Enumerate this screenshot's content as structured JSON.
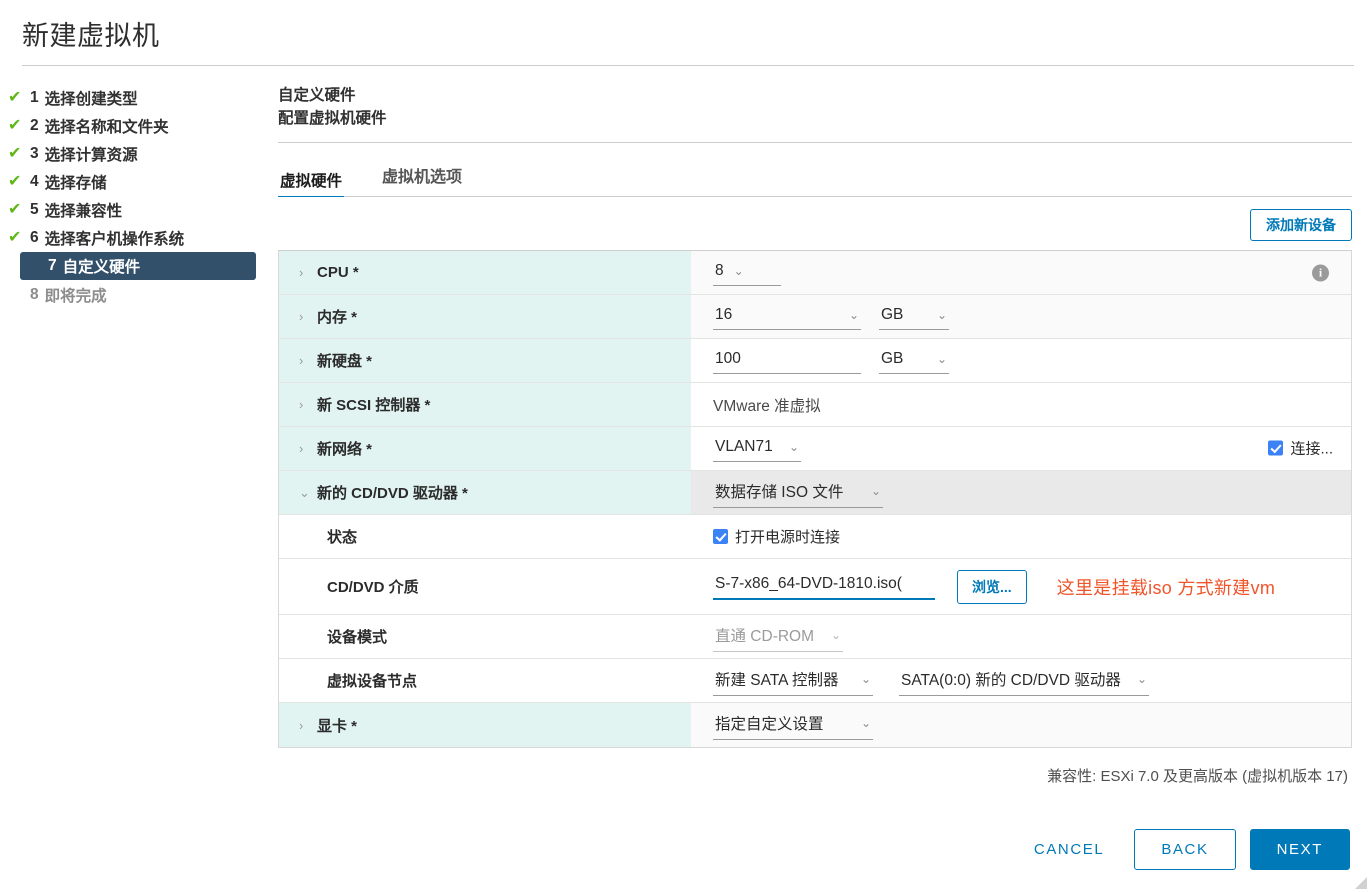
{
  "window": {
    "title": "新建虚拟机"
  },
  "sidebar": {
    "items": [
      {
        "num": "1",
        "label": "选择创建类型",
        "state": "done"
      },
      {
        "num": "2",
        "label": "选择名称和文件夹",
        "state": "done"
      },
      {
        "num": "3",
        "label": "选择计算资源",
        "state": "done"
      },
      {
        "num": "4",
        "label": "选择存储",
        "state": "done"
      },
      {
        "num": "5",
        "label": "选择兼容性",
        "state": "done"
      },
      {
        "num": "6",
        "label": "选择客户机操作系统",
        "state": "done"
      },
      {
        "num": "7",
        "label": "自定义硬件",
        "state": "active"
      },
      {
        "num": "8",
        "label": "即将完成",
        "state": "pending"
      }
    ],
    "check_glyph": "✔"
  },
  "pane": {
    "title": "自定义硬件",
    "subtitle": "配置虚拟机硬件"
  },
  "tabs": [
    {
      "label": "虚拟硬件",
      "selected": true
    },
    {
      "label": "虚拟机选项",
      "selected": false
    }
  ],
  "toolbar": {
    "add_device_label": "添加新设备"
  },
  "hardware": {
    "cpu": {
      "label": "CPU *",
      "value": "8",
      "caret": "›",
      "info_glyph": "i"
    },
    "memory": {
      "label": "内存 *",
      "value": "16",
      "unit": "GB",
      "caret": "›"
    },
    "harddisk": {
      "label": "新硬盘 *",
      "value": "100",
      "unit": "GB",
      "caret": "›"
    },
    "scsi": {
      "label": "新 SCSI 控制器 *",
      "value": "VMware 准虚拟",
      "caret": "›"
    },
    "network": {
      "label": "新网络 *",
      "value": "VLAN71",
      "connect_label": "连接...",
      "connect_checked": true,
      "caret": "›"
    },
    "cddvd": {
      "label": "新的 CD/DVD 驱动器 *",
      "value": "数据存储 ISO 文件",
      "caret": "⌄",
      "rows": {
        "status": {
          "label": "状态",
          "checkbox_label": "打开电源时连接",
          "checked": true
        },
        "media": {
          "label": "CD/DVD 介质",
          "value": ")S-7-x86_64-DVD-1810.iso",
          "browse_label": "浏览...",
          "annotation": "这里是挂载iso 方式新建vm"
        },
        "device_mode": {
          "label": "设备模式",
          "value": "直通 CD-ROM",
          "disabled": true
        },
        "device_node": {
          "label": "虚拟设备节点",
          "controller": "新建 SATA 控制器",
          "node": "SATA(0:0) 新的 CD/DVD 驱动器"
        }
      }
    },
    "videocard": {
      "label": "显卡 *",
      "value": "指定自定义设置",
      "caret": "›"
    }
  },
  "compatibility": "兼容性: ESXi 7.0 及更高版本 (虚拟机版本 17)",
  "footer": {
    "cancel": "CANCEL",
    "back": "BACK",
    "next": "NEXT"
  },
  "colors": {
    "accent": "#0079b8",
    "active_step": "#33506b",
    "check_green": "#5eb715",
    "label_cell": "#e1f4f1",
    "annotation": "#f0552a",
    "checkbox": "#3b82f6"
  }
}
